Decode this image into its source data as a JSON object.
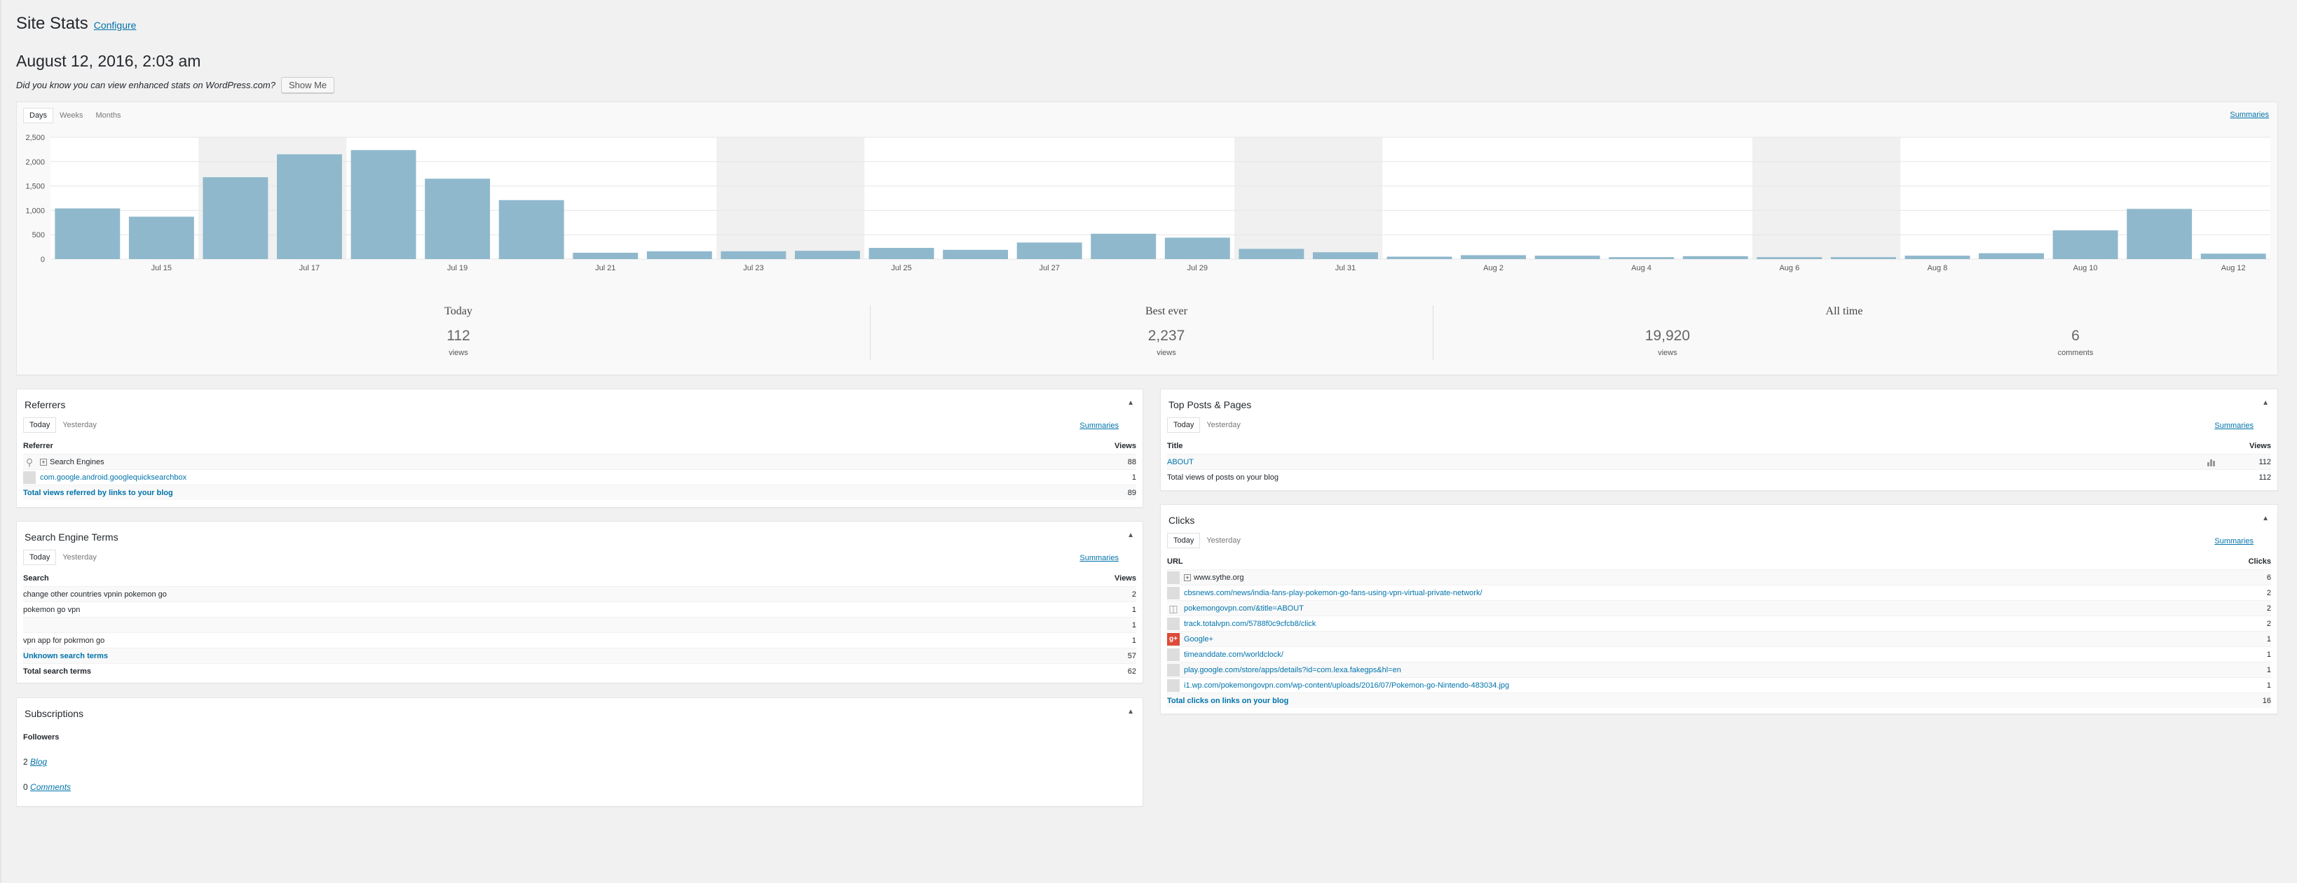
{
  "page": {
    "title": "Site Stats",
    "configure_label": "Configure",
    "datetime": "August 12, 2016, 2:03 am",
    "notice": "Did you know you can view enhanced stats on WordPress.com?",
    "show_me_label": "Show Me"
  },
  "chart_panel": {
    "tabs": [
      "Days",
      "Weeks",
      "Months"
    ],
    "summaries_label": "Summaries"
  },
  "chart_data": {
    "type": "bar",
    "categories": [
      "Jul 14",
      "Jul 15",
      "Jul 16",
      "Jul 17",
      "Jul 18",
      "Jul 19",
      "Jul 20",
      "Jul 21",
      "Jul 22",
      "Jul 23",
      "Jul 24",
      "Jul 25",
      "Jul 26",
      "Jul 27",
      "Jul 28",
      "Jul 29",
      "Jul 30",
      "Jul 31",
      "Aug 1",
      "Aug 2",
      "Aug 3",
      "Aug 4",
      "Aug 5",
      "Aug 6",
      "Aug 7",
      "Aug 8",
      "Aug 9",
      "Aug 10",
      "Aug 11",
      "Aug 12"
    ],
    "tick_labels": [
      "Jul 15",
      "Jul 17",
      "Jul 19",
      "Jul 21",
      "Jul 23",
      "Jul 25",
      "Jul 27",
      "Jul 29",
      "Jul 31",
      "Aug 2",
      "Aug 4",
      "Aug 6",
      "Aug 8",
      "Aug 10",
      "Aug 12"
    ],
    "values": [
      1040,
      870,
      1680,
      2150,
      2237,
      1650,
      1210,
      130,
      160,
      160,
      170,
      230,
      190,
      340,
      520,
      440,
      210,
      140,
      50,
      80,
      70,
      40,
      60,
      40,
      40,
      70,
      120,
      590,
      1030,
      112
    ],
    "yticks": [
      0,
      500,
      "1,000",
      "1,500",
      "2,000",
      "2,500"
    ],
    "ylim": [
      0,
      2500
    ],
    "grid": true,
    "weekend_bands": [
      [
        2,
        3
      ],
      [
        9,
        10
      ],
      [
        16,
        17
      ],
      [
        23,
        24
      ]
    ],
    "bar_color": "#8fb8cc",
    "band_color": "#f0f0f0"
  },
  "summary": [
    {
      "label": "Today",
      "value": "112",
      "unit": "views"
    },
    {
      "label": "Best ever",
      "value": "2,237",
      "unit": "views"
    },
    {
      "label": "All time",
      "value": "19,920",
      "unit": "views",
      "value2": "6",
      "unit2": "comments"
    }
  ],
  "referrers": {
    "title": "Referrers",
    "tabs": [
      "Today",
      "Yesterday"
    ],
    "summaries_label": "Summaries",
    "col1": "Referrer",
    "col2": "Views",
    "rows": [
      {
        "label": "Search Engines",
        "value": "88",
        "icon": "search-icon"
      },
      {
        "label": "com.google.android.googlequicksearchbox",
        "value": "1",
        "icon": "favicon-placeholder"
      }
    ],
    "total_label": "Total views referred by links to your blog",
    "total_value": "89"
  },
  "search_terms": {
    "title": "Search Engine Terms",
    "tabs": [
      "Today",
      "Yesterday"
    ],
    "summaries_label": "Summaries",
    "col1": "Search",
    "col2": "Views",
    "rows": [
      {
        "label": "change other countries vpnin pokemon go",
        "value": "2"
      },
      {
        "label": "pokemon go vpn",
        "value": "1"
      },
      {
        "label": "",
        "value": "1"
      },
      {
        "label": "vpn app for pokrmon go",
        "value": "1"
      }
    ],
    "unknown_label": "Unknown search terms",
    "unknown_value": "57",
    "total_label": "Total search terms",
    "total_value": "62"
  },
  "subscriptions": {
    "title": "Subscriptions",
    "followers_label": "Followers",
    "blog_count": "2",
    "blog_label": "Blog",
    "comments_count": "0",
    "comments_label": "Comments"
  },
  "top_posts": {
    "title": "Top Posts & Pages",
    "tabs": [
      "Today",
      "Yesterday"
    ],
    "summaries_label": "Summaries",
    "col1": "Title",
    "col2": "Views",
    "rows": [
      {
        "label": "ABOUT",
        "value": "112"
      }
    ],
    "total_label": "Total views of posts on your blog",
    "total_value": "112"
  },
  "clicks": {
    "title": "Clicks",
    "tabs": [
      "Today",
      "Yesterday"
    ],
    "summaries_label": "Summaries",
    "col1": "URL",
    "col2": "Clicks",
    "rows": [
      {
        "label": "www.sythe.org",
        "value": "6",
        "expand": true
      },
      {
        "label": "cbsnews.com/news/india-fans-play-pokemon-go-fans-using-vpn-virtual-private-network/",
        "value": "2"
      },
      {
        "label": "pokemongovpn.com/&title=ABOUT",
        "value": "2"
      },
      {
        "label": "track.totalvpn.com/5788f0c9cfcb8/click",
        "value": "2"
      },
      {
        "label": "Google+",
        "value": "1",
        "gplus": true
      },
      {
        "label": "timeanddate.com/worldclock/",
        "value": "1"
      },
      {
        "label": "play.google.com/store/apps/details?id=com.lexa.fakegps&hl=en",
        "value": "1"
      },
      {
        "label": "i1.wp.com/pokemongovpn.com/wp-content/uploads/2016/07/Pokemon-go-Nintendo-483034.jpg",
        "value": "1"
      }
    ],
    "total_label": "Total clicks on links on your blog",
    "total_value": "16"
  }
}
